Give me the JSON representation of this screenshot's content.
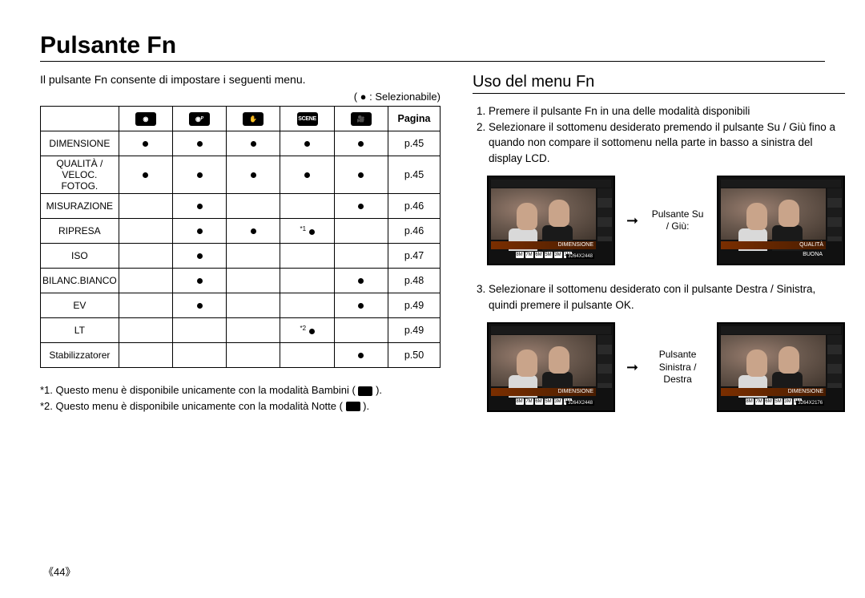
{
  "title": "Pulsante Fn",
  "intro": "Il pulsante Fn consente di impostare i seguenti menu.",
  "legend": "( ● : Selezionabile)",
  "table": {
    "page_col_header": "Pagina",
    "modes": [
      "camera-icon",
      "cameraP-icon",
      "hand-icon",
      "SCENE",
      "video-icon"
    ],
    "rows": [
      {
        "label": "DIMENSIONE",
        "cells": [
          "●",
          "●",
          "●",
          "●",
          "●"
        ],
        "page": "p.45"
      },
      {
        "label": "QUALITÀ / VELOC. FOTOG.",
        "cells": [
          "●",
          "●",
          "●",
          "●",
          "●"
        ],
        "page": "p.45"
      },
      {
        "label": "MISURAZIONE",
        "cells": [
          "",
          "●",
          "",
          "",
          "●"
        ],
        "page": "p.46"
      },
      {
        "label": "RIPRESA",
        "cells": [
          "",
          "●",
          "●",
          "*1 ●",
          ""
        ],
        "page": "p.46"
      },
      {
        "label": "ISO",
        "cells": [
          "",
          "●",
          "",
          "",
          ""
        ],
        "page": "p.47"
      },
      {
        "label": "BILANC.BIANCO",
        "cells": [
          "",
          "●",
          "",
          "",
          "●"
        ],
        "page": "p.48"
      },
      {
        "label": "EV",
        "cells": [
          "",
          "●",
          "",
          "",
          "●"
        ],
        "page": "p.49"
      },
      {
        "label": "LT",
        "cells": [
          "",
          "",
          "",
          "*2 ●",
          ""
        ],
        "page": "p.49"
      },
      {
        "label": "Stabilizzatorer",
        "cells": [
          "",
          "",
          "",
          "",
          "●"
        ],
        "page": "p.50"
      }
    ]
  },
  "footnotes": {
    "f1_pre": "*1. Questo menu è disponibile unicamente con la modalità Bambini ( ",
    "f1_post": " ).",
    "f2_pre": "*2. Questo menu è disponibile unicamente con la modalità Notte ( ",
    "f2_post": " )."
  },
  "right": {
    "title": "Uso del menu Fn",
    "step1": "Premere il pulsante Fn in una delle modalità disponibili",
    "step2": "Selezionare il sottomenu desiderato premendo il pulsante Su / Giù fino a quando non compare il sottomenu nella parte in basso a sinistra del display LCD.",
    "step3": "Selezionare il sottomenu desiderato con il pulsante Destra / Sinistra, quindi premere il pulsante OK.",
    "caption1": "Pulsante Su / Giù:",
    "caption2": "Pulsante Sinistra / Destra",
    "lcd": {
      "label_dimensione": "DIMENSIONE",
      "label_qualita": "QUALITÀ",
      "label_buona": "BUONA",
      "pips": [
        "8M",
        "7M",
        "6M",
        "5M",
        "3M",
        "1M"
      ],
      "res1": "3264X2448",
      "res2": "3264X2448",
      "res3": "3264X2176"
    }
  },
  "page_number": "《44》"
}
